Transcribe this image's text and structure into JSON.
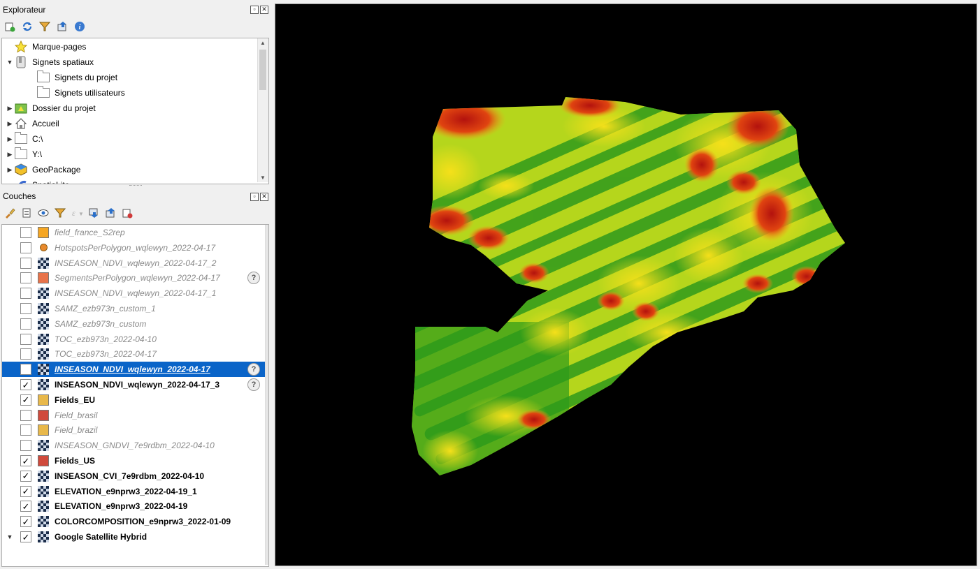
{
  "explorer": {
    "title": "Explorateur",
    "toolbar_icons": [
      "add-layer-icon",
      "refresh-icon",
      "filter-icon",
      "collapse-icon",
      "info-icon"
    ],
    "items": [
      {
        "label": "Marque-pages",
        "icon": "star-icon",
        "arrow": ""
      },
      {
        "label": "Signets spatiaux",
        "icon": "bookmark-icon",
        "arrow": "▼"
      },
      {
        "label": "Signets du projet",
        "icon": "folder-icon",
        "arrow": ""
      },
      {
        "label": "Signets utilisateurs",
        "icon": "folder-icon",
        "arrow": ""
      },
      {
        "label": "Dossier du projet",
        "icon": "project-folder-icon",
        "arrow": "▶"
      },
      {
        "label": "Accueil",
        "icon": "home-icon",
        "arrow": "▶"
      },
      {
        "label": "C:\\",
        "icon": "folder-icon",
        "arrow": "▶"
      },
      {
        "label": "Y:\\",
        "icon": "folder-icon",
        "arrow": "▶"
      },
      {
        "label": "GeoPackage",
        "icon": "geopackage-icon",
        "arrow": "▶"
      },
      {
        "label": "SpatiaLite",
        "icon": "spatialite-icon",
        "arrow": ""
      }
    ]
  },
  "layers": {
    "title": "Couches",
    "toolbar_icons": [
      "style-icon",
      "add-group-icon",
      "visibility-icon",
      "filter-icon",
      "expression-icon",
      "expand-icon",
      "collapse-icon",
      "remove-layer-icon"
    ],
    "items": [
      {
        "label": "field_france_S2rep",
        "checked": false,
        "kind": "swatch",
        "color": "#f5a623",
        "badge": false
      },
      {
        "label": "HotspotsPerPolygon_wqlewyn_2022-04-17",
        "checked": false,
        "kind": "dot",
        "color": "#e8892c",
        "badge": false
      },
      {
        "label": "INSEASON_NDVI_wqlewyn_2022-04-17_2",
        "checked": false,
        "kind": "raster",
        "badge": false
      },
      {
        "label": "SegmentsPerPolygon_wqlewyn_2022-04-17",
        "checked": false,
        "kind": "swatch",
        "color": "#e8734a",
        "badge": true
      },
      {
        "label": "INSEASON_NDVI_wqlewyn_2022-04-17_1",
        "checked": false,
        "kind": "raster",
        "badge": false
      },
      {
        "label": "SAMZ_ezb973n_custom_1",
        "checked": false,
        "kind": "raster",
        "badge": false
      },
      {
        "label": "SAMZ_ezb973n_custom",
        "checked": false,
        "kind": "raster",
        "badge": false
      },
      {
        "label": "TOC_ezb973n_2022-04-10",
        "checked": false,
        "kind": "raster",
        "badge": false
      },
      {
        "label": "TOC_ezb973n_2022-04-17",
        "checked": false,
        "kind": "raster",
        "badge": false
      },
      {
        "label": "INSEASON_NDVI_wqlewyn_2022-04-17",
        "checked": false,
        "kind": "raster",
        "badge": true,
        "selected": true
      },
      {
        "label": "INSEASON_NDVI_wqlewyn_2022-04-17_3",
        "checked": true,
        "kind": "raster",
        "badge": true
      },
      {
        "label": "Fields_EU",
        "checked": true,
        "kind": "swatch",
        "color": "#e8b84a",
        "badge": false
      },
      {
        "label": "Field_brasil",
        "checked": false,
        "kind": "swatch",
        "color": "#d04a3c",
        "badge": false
      },
      {
        "label": "Field_brazil",
        "checked": false,
        "kind": "swatch",
        "color": "#e8b84a",
        "badge": false
      },
      {
        "label": "INSEASON_GNDVI_7e9rdbm_2022-04-10",
        "checked": false,
        "kind": "raster",
        "badge": false
      },
      {
        "label": "Fields_US",
        "checked": true,
        "kind": "swatch",
        "color": "#d04a3c",
        "badge": false
      },
      {
        "label": "INSEASON_CVI_7e9rdbm_2022-04-10",
        "checked": true,
        "kind": "raster",
        "badge": false
      },
      {
        "label": "ELEVATION_e9nprw3_2022-04-19_1",
        "checked": true,
        "kind": "raster",
        "badge": false
      },
      {
        "label": "ELEVATION_e9nprw3_2022-04-19",
        "checked": true,
        "kind": "raster",
        "badge": false
      },
      {
        "label": "COLORCOMPOSITION_e9nprw3_2022-01-09",
        "checked": true,
        "kind": "raster",
        "badge": false
      },
      {
        "label": "Google Satellite Hybrid",
        "checked": true,
        "kind": "raster",
        "badge": false,
        "arrow": "▼"
      }
    ]
  },
  "badge_symbol": "?",
  "check_symbol": "✓"
}
